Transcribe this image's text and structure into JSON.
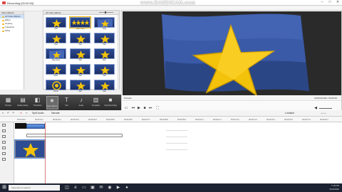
{
  "titlebar": {
    "title": "Recording [00:00:00]",
    "watermark": "www.BANDICAM.com"
  },
  "window_buttons": [
    "–",
    "□",
    "✕"
  ],
  "left_panel": {
    "header": "Video Effects",
    "items": [
      {
        "label": "All Video Effects",
        "selected": true
      },
      {
        "label": "Effect",
        "selected": false
      },
      {
        "label": "Overlay",
        "selected": false
      },
      {
        "label": "Transition",
        "selected": false
      },
      {
        "label": "Other",
        "selected": false
      }
    ]
  },
  "gallery": {
    "header": "All Video Effects",
    "thumbs": [
      {
        "caption": "Star",
        "variant": "star"
      },
      {
        "caption": "Stars multi",
        "variant": "stars"
      },
      {
        "caption": "Flag",
        "variant": "flag"
      },
      {
        "caption": "Star",
        "variant": "star"
      },
      {
        "caption": "Star",
        "variant": "star"
      },
      {
        "caption": "Star",
        "variant": "star"
      },
      {
        "caption": "Flag wave",
        "variant": "flag"
      },
      {
        "caption": "Star",
        "variant": "star"
      },
      {
        "caption": "Spin",
        "variant": "star"
      },
      {
        "caption": "Flare",
        "variant": "star"
      },
      {
        "caption": "Star",
        "variant": "star"
      },
      {
        "caption": "Star",
        "variant": "star"
      },
      {
        "caption": "Circle",
        "variant": "circle"
      },
      {
        "caption": "Star",
        "variant": "star"
      },
      {
        "caption": "Star",
        "variant": "star"
      }
    ]
  },
  "preview": {
    "label": "Preview",
    "time": "00:00:00.000 / 00:00:00"
  },
  "toolbar": {
    "items": [
      {
        "label": "Preview",
        "icon": "▦",
        "name": "preview"
      },
      {
        "label": "Media Library",
        "icon": "▤",
        "name": "media"
      },
      {
        "label": "Transitions",
        "icon": "◧",
        "name": "transitions"
      },
      {
        "label": "Video Effects",
        "icon": "★",
        "name": "video-effects",
        "active": true
      },
      {
        "label": "Text",
        "icon": "T",
        "name": "text"
      },
      {
        "label": "Audio",
        "icon": "♪",
        "name": "audio"
      },
      {
        "label": "Templates",
        "icon": "▥",
        "name": "templates"
      },
      {
        "label": "Stop Recording",
        "icon": "■",
        "name": "stop"
      }
    ]
  },
  "editbar": {
    "split": "Split Audio",
    "undo": "↶",
    "redo": "↷",
    "delete": "✕",
    "location": "Location",
    "narrate": "Narrate"
  },
  "ruler": {
    "ticks": [
      "00:00:00.0",
      "00:00:01.1",
      "00:00:02.2",
      "00:00:03.3",
      "00:00:04.4",
      "00:00:05.5",
      "00:00:06.6",
      "00:00:07.7",
      "00:00:08.8",
      "00:00:09.9",
      "00:00:11.0",
      "00:00:12.1",
      "00:00:13.2",
      "00:00:14.3",
      "00:00:15.4",
      "00:00:16.5",
      "00:00:17.6",
      "00:00:18.7"
    ]
  },
  "taskbar": {
    "search_placeholder": "Type here to search",
    "time": "7:18 PM",
    "date": "5/20/2020"
  },
  "colors": {
    "accent": "#f2b600",
    "preview_bg": "#2e4c93",
    "toolbar": "#3a3a3a"
  }
}
